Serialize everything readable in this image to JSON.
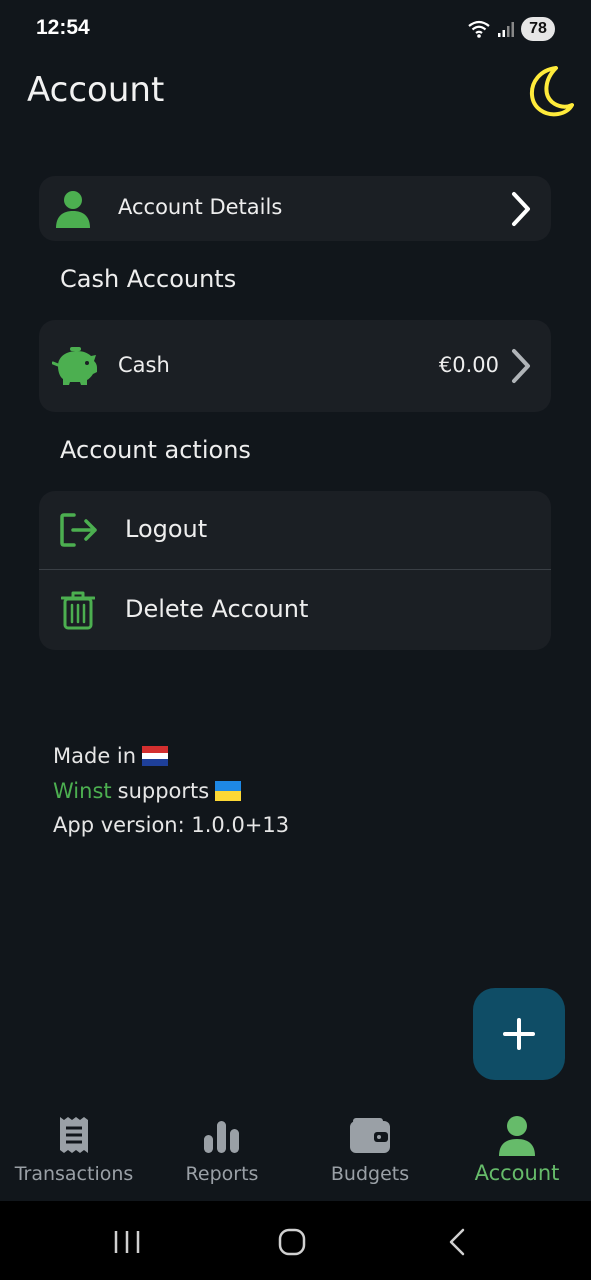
{
  "status_bar": {
    "time": "12:54",
    "battery": "78"
  },
  "header": {
    "title": "Account"
  },
  "account_details": {
    "label": "Account Details"
  },
  "cash_accounts": {
    "section_title": "Cash Accounts",
    "items": [
      {
        "name": "Cash",
        "balance": "€0.00"
      }
    ]
  },
  "account_actions": {
    "section_title": "Account actions",
    "logout_label": "Logout",
    "delete_label": "Delete Account"
  },
  "footer": {
    "made_in": "Made in",
    "brand": "Winst",
    "supports": "supports",
    "version": "App version: 1.0.0+13"
  },
  "bottom_nav": {
    "items": [
      {
        "label": "Transactions",
        "icon": "receipt-icon"
      },
      {
        "label": "Reports",
        "icon": "bar-chart-icon"
      },
      {
        "label": "Budgets",
        "icon": "wallet-icon"
      },
      {
        "label": "Account",
        "icon": "person-icon"
      }
    ],
    "active": "Account"
  },
  "colors": {
    "accent_green": "#4caf50",
    "fab_background": "#0f4d66",
    "moon_yellow": "#ffeb3b",
    "card_background": "#1b1f24",
    "page_background": "#11161b"
  }
}
